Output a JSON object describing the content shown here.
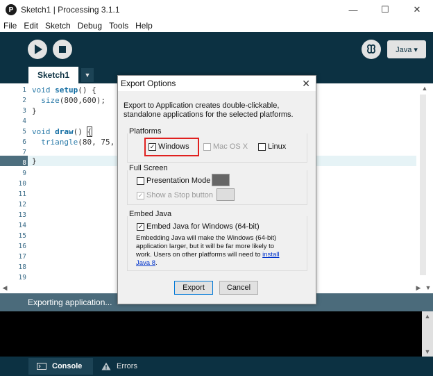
{
  "window": {
    "title": "Sketch1 | Processing 3.1.1",
    "minimize": "—",
    "maximize": "☐",
    "close": "✕"
  },
  "menu": [
    "File",
    "Edit",
    "Sketch",
    "Debug",
    "Tools",
    "Help"
  ],
  "toolbar": {
    "mode_label": "Java ▾"
  },
  "tabs": {
    "sketch_tab": "Sketch1",
    "tab_menu": "▼"
  },
  "editor": {
    "line_numbers": [
      "1",
      "2",
      "3",
      "4",
      "5",
      "6",
      "7",
      "8",
      "9",
      "10",
      "11",
      "12",
      "13",
      "14",
      "15",
      "16",
      "17",
      "18",
      "19"
    ],
    "line1": {
      "kw": "void",
      "fn": "setup",
      "rest": "() {"
    },
    "line2": {
      "fn": "size",
      "rest": "(800,600);"
    },
    "line3": "}",
    "line5": {
      "kw": "void",
      "fn": "draw",
      "rest": "() ",
      "bracket": "{"
    },
    "line6": {
      "fn": "triangle",
      "rest": "(80, 75,"
    },
    "line8": "}"
  },
  "status": {
    "text": "Exporting application..."
  },
  "bottom_tabs": {
    "console": "Console",
    "errors": "Errors"
  },
  "dialog": {
    "title": "Export Options",
    "close": "✕",
    "description": "Export to Application creates double-clickable, standalone applications for the selected platforms.",
    "platforms": {
      "label": "Platforms",
      "windows": {
        "label": "Windows",
        "checked": true
      },
      "macosx": {
        "label": "Mac OS X",
        "checked": false,
        "disabled": true
      },
      "linux": {
        "label": "Linux",
        "checked": false
      }
    },
    "fullscreen": {
      "label": "Full Screen",
      "presentation": {
        "label": "Presentation Mode",
        "checked": false
      },
      "stop_button": {
        "label": "Show a Stop button",
        "checked": true,
        "disabled": true
      }
    },
    "embed_java": {
      "label": "Embed Java",
      "checkbox": {
        "label": "Embed Java for Windows (64-bit)",
        "checked": true
      },
      "note": "Embedding Java will make the Windows (64-bit) application larger, but it will be far more likely to work. Users on other platforms will need to ",
      "link": "install Java 8",
      "note_end": "."
    },
    "buttons": {
      "export": "Export",
      "cancel": "Cancel"
    }
  },
  "colors": {
    "toolbar_bg": "#0c3142",
    "status_bg": "#4b6b7b",
    "highlight_red": "#e0201f",
    "presentation_swatch": "#666666",
    "stop_swatch": "#dddddd"
  }
}
